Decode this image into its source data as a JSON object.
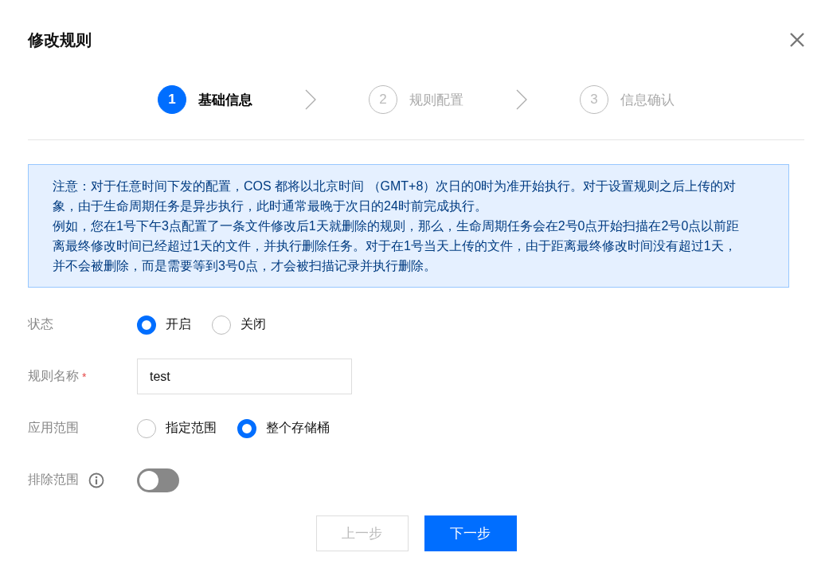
{
  "dialog": {
    "title": "修改规则"
  },
  "steps": [
    {
      "number": "1",
      "label": "基础信息",
      "selected": true
    },
    {
      "number": "2",
      "label": "规则配置",
      "selected": false
    },
    {
      "number": "3",
      "label": "信息确认",
      "selected": false
    }
  ],
  "notice": {
    "paragraphs": [
      "注意：对于任意时间下发的配置，COS 都将以北京时间 （GMT+8）次日的0时为准开始执行。对于设置规则之后上传的对象，由于生命周期任务是异步执行，此时通常最晚于次日的24时前完成执行。",
      "例如，您在1号下午3点配置了一条文件修改后1天就删除的规则，那么，生命周期任务会在2号0点开始扫描在2号0点以前距离最终修改时间已经超过1天的文件，并执行删除任务。对于在1号当天上传的文件，由于距离最终修改时间没有超过1天，并不会被删除，而是需要等到3号0点，才会被扫描记录并执行删除。"
    ]
  },
  "form": [
    {
      "kind": "radio",
      "label": "状态",
      "options": [
        {
          "label": "开启",
          "selected": true
        },
        {
          "label": "关闭",
          "selected": false
        }
      ]
    },
    {
      "kind": "input",
      "label": "规则名称",
      "required_mark": "*",
      "value": "test"
    },
    {
      "kind": "radio",
      "label": "应用范围",
      "options": [
        {
          "label": "指定范围",
          "selected": false
        },
        {
          "label": "整个存储桶",
          "selected": true
        }
      ]
    },
    {
      "kind": "toggle",
      "label": "排除范围",
      "info": true,
      "on": false
    }
  ],
  "buttons": [
    {
      "label": "上一步",
      "disabled": true,
      "primary": false
    },
    {
      "label": "下一步",
      "disabled": false,
      "primary": true
    }
  ]
}
